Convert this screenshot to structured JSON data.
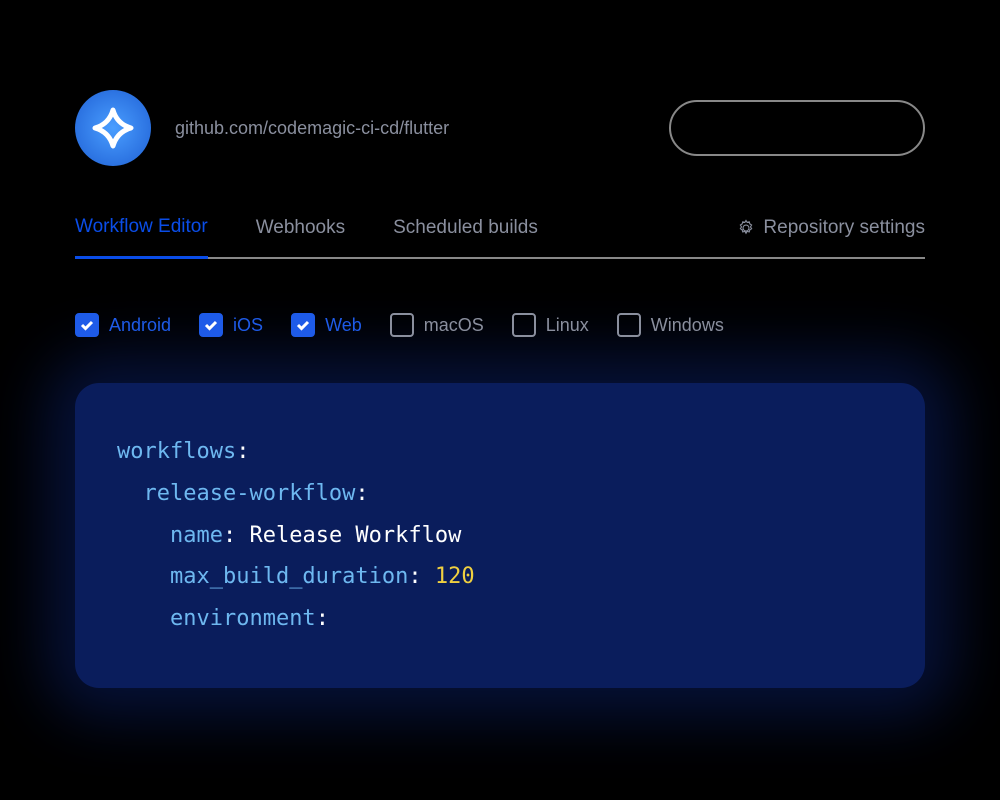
{
  "header": {
    "repo_url": "github.com/codemagic-ci-cd/flutter"
  },
  "tabs": {
    "items": [
      {
        "label": "Workflow Editor",
        "active": true
      },
      {
        "label": "Webhooks",
        "active": false
      },
      {
        "label": "Scheduled builds",
        "active": false
      }
    ],
    "settings_label": "Repository settings"
  },
  "platforms": [
    {
      "label": "Android",
      "checked": true
    },
    {
      "label": "iOS",
      "checked": true
    },
    {
      "label": "Web",
      "checked": true
    },
    {
      "label": "macOS",
      "checked": false
    },
    {
      "label": "Linux",
      "checked": false
    },
    {
      "label": "Windows",
      "checked": false
    }
  ],
  "code": {
    "lines": [
      {
        "indent": 0,
        "key": "workflows",
        "value": "",
        "value_type": "none"
      },
      {
        "indent": 1,
        "key": "release-workflow",
        "value": "",
        "value_type": "none"
      },
      {
        "indent": 2,
        "key": "name",
        "value": "Release Workflow",
        "value_type": "text"
      },
      {
        "indent": 2,
        "key": "max_build_duration",
        "value": "120",
        "value_type": "number"
      },
      {
        "indent": 2,
        "key": "environment",
        "value": "",
        "value_type": "none"
      }
    ]
  }
}
